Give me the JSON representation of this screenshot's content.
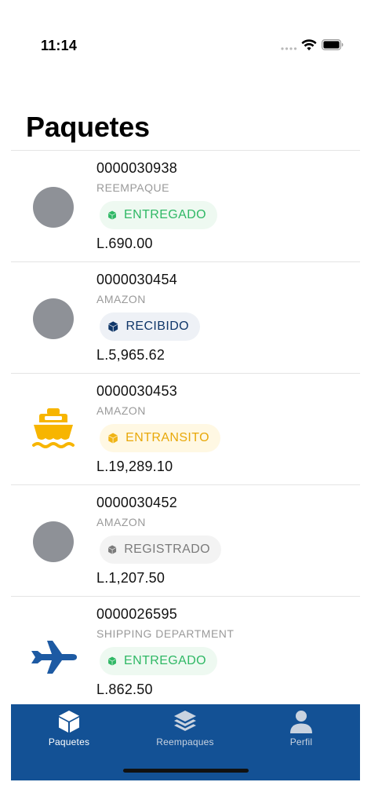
{
  "status_bar": {
    "time": "11:14"
  },
  "page": {
    "title": "Paquetes"
  },
  "colors": {
    "tab_bar": "#135195",
    "entregado": "#2fb865",
    "recibido": "#0f3669",
    "entransito": "#f0b416",
    "registrado": "#7b7b7b"
  },
  "packages": [
    {
      "number": "0000030938",
      "origin": "REEMPAQUE",
      "status": "ENTREGADO",
      "price": "L.690.00",
      "icon": "placeholder-circle"
    },
    {
      "number": "0000030454",
      "origin": "AMAZON",
      "status": "RECIBIDO",
      "price": "L.5,965.62",
      "icon": "placeholder-circle"
    },
    {
      "number": "0000030453",
      "origin": "AMAZON",
      "status": "ENTRANSITO",
      "price": "L.19,289.10",
      "icon": "ship-icon"
    },
    {
      "number": "0000030452",
      "origin": "AMAZON",
      "status": "REGISTRADO",
      "price": "L.1,207.50",
      "icon": "placeholder-circle"
    },
    {
      "number": "0000026595",
      "origin": "SHIPPING DEPARTMENT",
      "status": "ENTREGADO",
      "price": "L.862.50",
      "icon": "airplane-icon"
    }
  ],
  "tabs": [
    {
      "label": "Paquetes",
      "icon": "box-icon",
      "active": true
    },
    {
      "label": "Reempaques",
      "icon": "layers-icon",
      "active": false
    },
    {
      "label": "Perfil",
      "icon": "person-icon",
      "active": false
    }
  ]
}
